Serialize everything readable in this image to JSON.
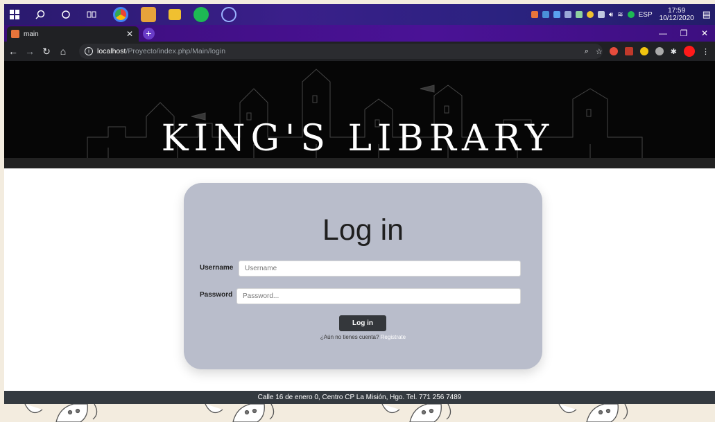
{
  "taskbar": {
    "clock_time": "17:59",
    "clock_date": "10/12/2020",
    "language": "ESP"
  },
  "browser": {
    "tab_title": "main",
    "url_host": "localhost",
    "url_path": "/Proyecto/index.php/Main/login"
  },
  "page": {
    "banner_title": "KING'S LIBRARY",
    "login": {
      "heading": "Log in",
      "username_label": "Username",
      "username_placeholder": "Username",
      "password_label": "Password",
      "password_placeholder": "Password...",
      "submit_label": "Log in",
      "signup_prompt": "¿Aún no tienes cuenta?",
      "signup_link": "Registrate"
    },
    "footer_text": "Calle 16 de enero 0, Centro CP La Misión, Hgo. Tel. 771 256 7489"
  },
  "colors": {
    "card_bg": "#b9bdcb",
    "footer_bg": "#343a40",
    "button_bg": "#34373b"
  }
}
